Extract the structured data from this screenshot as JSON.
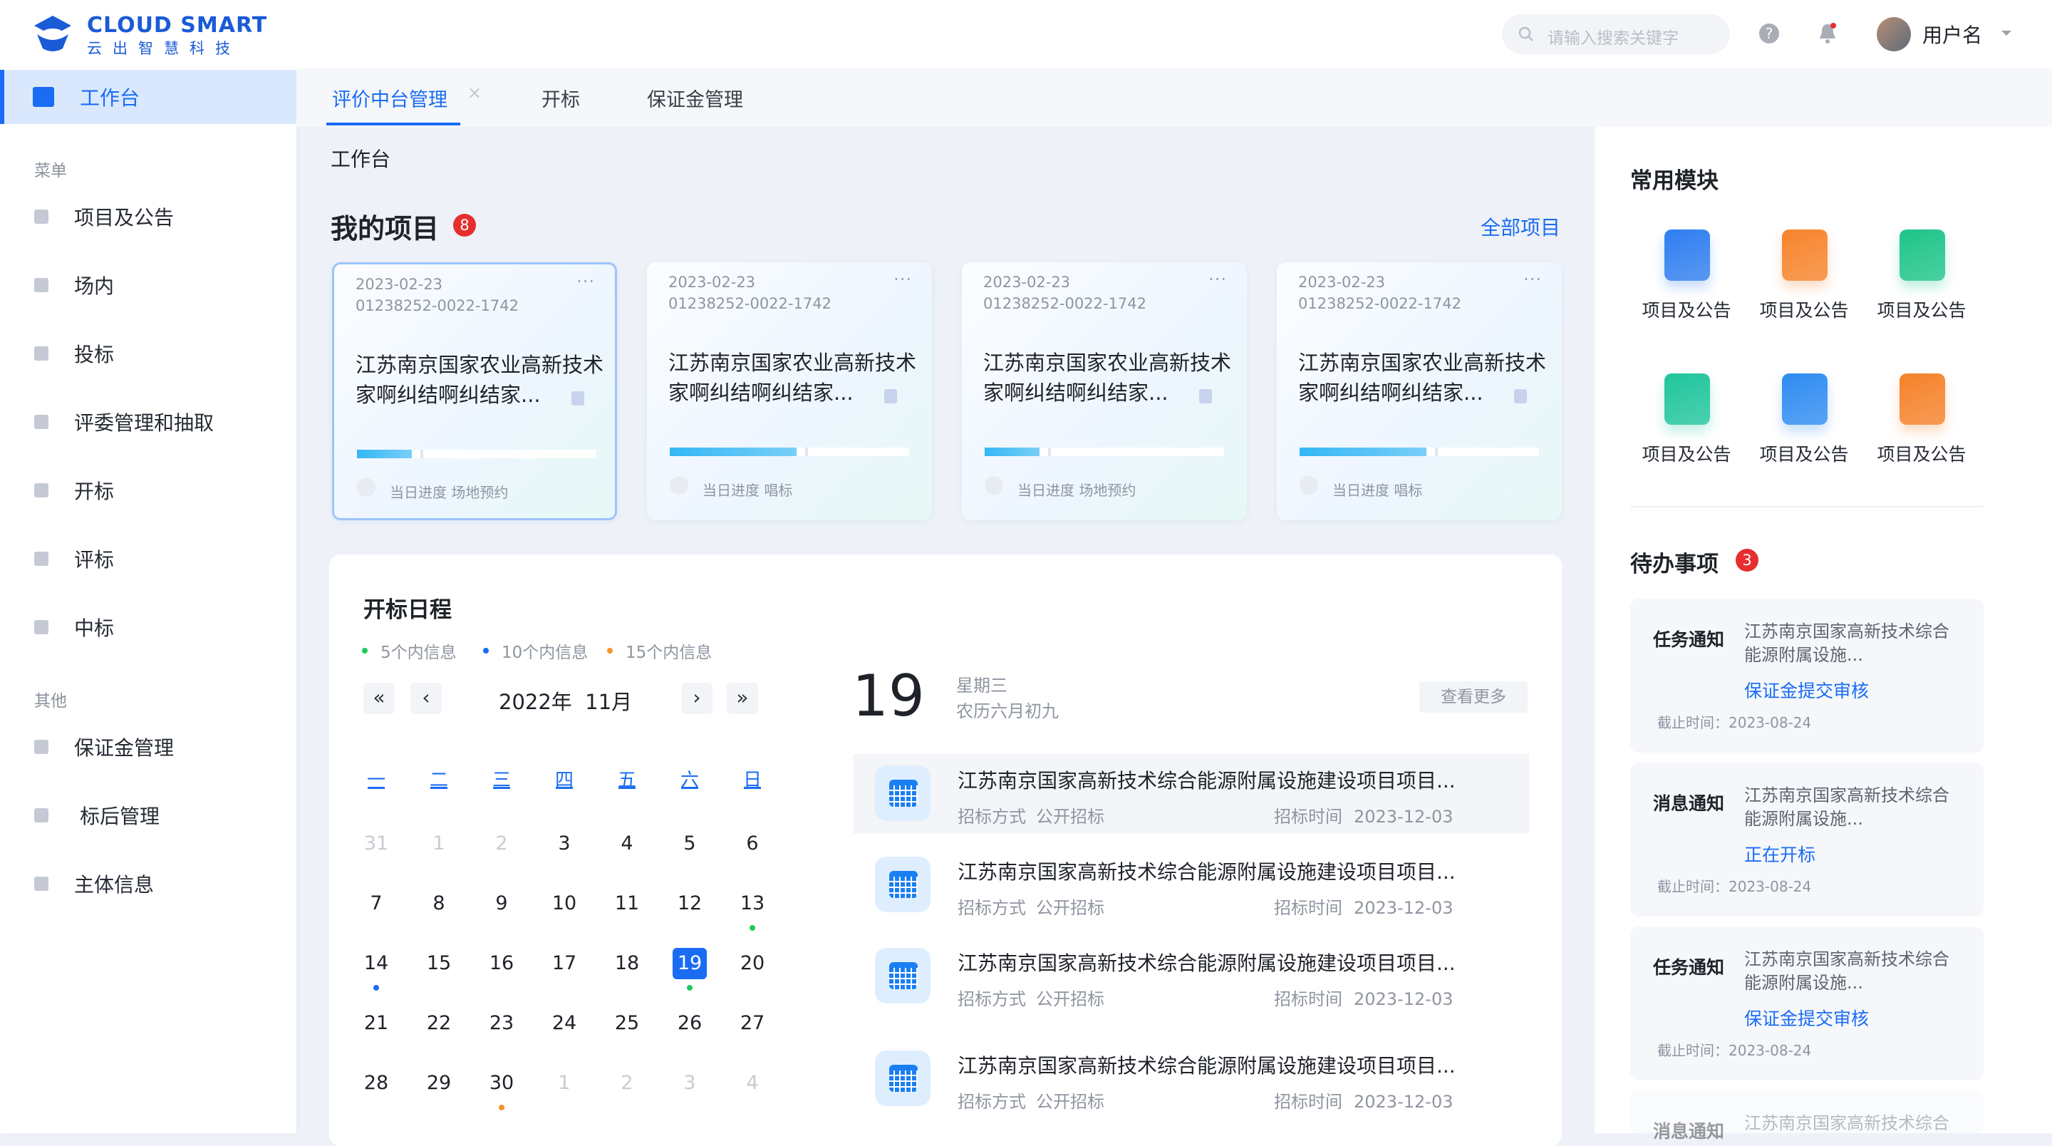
{
  "brand": {
    "title": "CLOUD SMART",
    "subtitle": "云出智慧科技"
  },
  "header": {
    "search_placeholder": "请输入搜索关键字",
    "user_name": "用户名",
    "icons": [
      "search-icon",
      "help-icon",
      "bell-icon",
      "avatar",
      "chevron-down-icon"
    ]
  },
  "sidebar": {
    "active": {
      "label": "工作台"
    },
    "group_menu": "菜单",
    "menu": [
      {
        "label": "项目及公告"
      },
      {
        "label": "场内"
      },
      {
        "label": "投标"
      },
      {
        "label": "评委管理和抽取"
      },
      {
        "label": "开标"
      },
      {
        "label": "评标"
      },
      {
        "label": "中标"
      }
    ],
    "group_other": "其他",
    "other": [
      {
        "label": "保证金管理"
      },
      {
        "label": "标后管理"
      },
      {
        "label": "主体信息"
      }
    ]
  },
  "tabs": [
    {
      "label": "评价中台管理",
      "active": true
    },
    {
      "label": "开标"
    },
    {
      "label": "保证金管理"
    }
  ],
  "breadcrumb": "工作台",
  "projects": {
    "title": "我的项目",
    "count": "8",
    "all_link": "全部项目",
    "cards": [
      {
        "date": "2023-02-23",
        "code": "01238252-0022-1742",
        "title": "江苏南京国家农业高新技术家啊纠结啊纠结家...",
        "progress": 0.23,
        "progress_label": "当日进度 场地预约"
      },
      {
        "date": "2023-02-23",
        "code": "01238252-0022-1742",
        "title": "江苏南京国家农业高新技术家啊纠结啊纠结家...",
        "progress": 0.53,
        "progress_label": "当日进度 唱标"
      },
      {
        "date": "2023-02-23",
        "code": "01238252-0022-1742",
        "title": "江苏南京国家农业高新技术家啊纠结啊纠结家...",
        "progress": 0.23,
        "progress_label": "当日进度 场地预约"
      },
      {
        "date": "2023-02-23",
        "code": "01238252-0022-1742",
        "title": "江苏南京国家农业高新技术家啊纠结啊纠结家...",
        "progress": 0.53,
        "progress_label": "当日进度 唱标"
      }
    ]
  },
  "schedule": {
    "title": "开标日程",
    "legend": [
      {
        "label": "5个内信息",
        "color": "#1ec85a"
      },
      {
        "label": "10个内信息",
        "color": "#1a6cf2"
      },
      {
        "label": "15个内信息",
        "color": "#f6932a"
      }
    ],
    "month": "2022年  11月",
    "weekdays": [
      "一",
      "二",
      "三",
      "四",
      "五",
      "六",
      "日"
    ],
    "weeks": [
      [
        "31",
        "1",
        "2",
        "3",
        "4",
        "5",
        "6"
      ],
      [
        "7",
        "8",
        "9",
        "10",
        "11",
        "12",
        "13"
      ],
      [
        "14",
        "15",
        "16",
        "17",
        "18",
        "19",
        "20"
      ],
      [
        "21",
        "22",
        "23",
        "24",
        "25",
        "26",
        "27"
      ],
      [
        "28",
        "29",
        "30",
        "1",
        "2",
        "3",
        "4"
      ]
    ],
    "day_big": "19",
    "weekday": "星期三",
    "lunar": "农历六月初九",
    "more": "查看更多",
    "events": [
      {
        "title": "江苏南京国家高新技术综合能源附属设施建设项目项目...",
        "method_label": "招标方式",
        "method": "公开招标",
        "time_label": "招标时间",
        "time": "2023-12-03"
      },
      {
        "title": "江苏南京国家高新技术综合能源附属设施建设项目项目...",
        "method_label": "招标方式",
        "method": "公开招标",
        "time_label": "招标时间",
        "time": "2023-12-03"
      },
      {
        "title": "江苏南京国家高新技术综合能源附属设施建设项目项目...",
        "method_label": "招标方式",
        "method": "公开招标",
        "time_label": "招标时间",
        "time": "2023-12-03"
      },
      {
        "title": "江苏南京国家高新技术综合能源附属设施建设项目项目...",
        "method_label": "招标方式",
        "method": "公开招标",
        "time_label": "招标时间",
        "time": "2023-12-03"
      }
    ]
  },
  "modules": {
    "title": "常用模块",
    "items": [
      {
        "label": "项目及公告",
        "color": "#2f7ef0"
      },
      {
        "label": "项目及公告",
        "color": "#f7842c"
      },
      {
        "label": "项目及公告",
        "color": "#1ec48a"
      },
      {
        "label": "项目及公告",
        "color": "#1fc59c"
      },
      {
        "label": "项目及公告",
        "color": "#2f8cf2"
      },
      {
        "label": "项目及公告",
        "color": "#f5822a"
      }
    ]
  },
  "todos": {
    "title": "待办事项",
    "count": "3",
    "items": [
      {
        "type": "任务通知",
        "text": "江苏南京国家高新技术综合能源附属设施...",
        "status": "保证金提交审核",
        "deadline": "截止时间：2023-08-24"
      },
      {
        "type": "消息通知",
        "text": "江苏南京国家高新技术综合能源附属设施...",
        "status": "正在开标",
        "deadline": "截止时间：2023-08-24"
      },
      {
        "type": "任务通知",
        "text": "江苏南京国家高新技术综合能源附属设施...",
        "status": "保证金提交审核",
        "deadline": "截止时间：2023-08-24"
      },
      {
        "type": "消息通知",
        "text": "江苏南京国家高新技术综合"
      }
    ]
  }
}
